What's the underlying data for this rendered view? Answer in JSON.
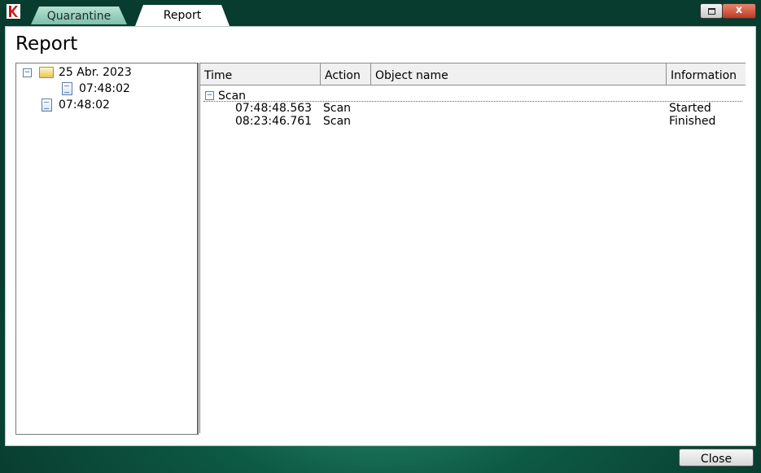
{
  "window": {
    "app_icon": "kaspersky-k-icon",
    "tabs": [
      {
        "label": "Quarantine",
        "active": false
      },
      {
        "label": "Report",
        "active": true
      }
    ],
    "controls": {
      "restore_icon": "restore-icon",
      "close_icon": "close-icon",
      "close_glyph": "x"
    }
  },
  "page": {
    "title": "Report"
  },
  "tree": {
    "items": [
      {
        "label": "25 Abr. 2023",
        "icon": "folder-icon",
        "expander": "−"
      },
      {
        "label": "07:48:02",
        "icon": "document-icon"
      },
      {
        "label": "07:48:02",
        "icon": "document-icon"
      }
    ]
  },
  "grid": {
    "columns": [
      "Time",
      "Action",
      "Object name",
      "Information"
    ],
    "group": {
      "label": "Scan",
      "expander": "−"
    },
    "rows": [
      {
        "time": "07:48:48.563",
        "action": "Scan",
        "object": "",
        "info": "Started"
      },
      {
        "time": "08:23:46.761",
        "action": "Scan",
        "object": "",
        "info": "Finished"
      }
    ]
  },
  "footer": {
    "close_label": "Close"
  },
  "colors": {
    "accent_bg": "#0d5a44",
    "close_btn": "#c13a22"
  }
}
